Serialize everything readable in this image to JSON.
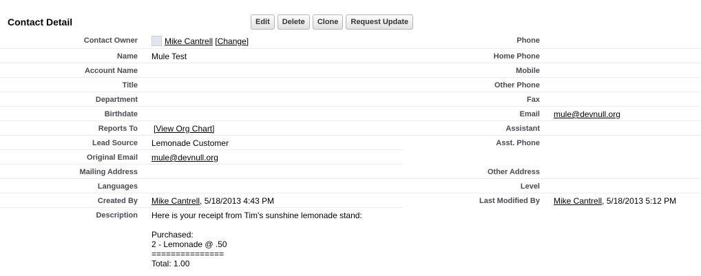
{
  "header": {
    "title": "Contact Detail"
  },
  "toolbar": {
    "edit": "Edit",
    "delete": "Delete",
    "clone": "Clone",
    "request_update": "Request Update"
  },
  "left": {
    "contact_owner": {
      "label": "Contact Owner",
      "name": "Mike Cantrell",
      "change": "[Change]"
    },
    "name": {
      "label": "Name",
      "value": "Mule Test"
    },
    "account_name": {
      "label": "Account Name",
      "value": ""
    },
    "title": {
      "label": "Title",
      "value": ""
    },
    "department": {
      "label": "Department",
      "value": ""
    },
    "birthdate": {
      "label": "Birthdate",
      "value": ""
    },
    "reports_to": {
      "label": "Reports To",
      "link": "[View Org Chart]"
    },
    "lead_source": {
      "label": "Lead Source",
      "value": "Lemonade Customer"
    },
    "original_email": {
      "label": "Original Email",
      "value": "mule@devnull.org"
    },
    "mailing_address": {
      "label": "Mailing Address",
      "value": ""
    },
    "languages": {
      "label": "Languages",
      "value": ""
    },
    "created_by": {
      "label": "Created By",
      "user": "Mike Cantrell",
      "date": ", 5/18/2013 4:43 PM"
    },
    "description": {
      "label": "Description",
      "lines": [
        "Here is your receipt from Tim's sunshine lemonade stand:",
        "",
        "Purchased:",
        "2 - Lemonade @ .50",
        "===============",
        "Total: 1.00"
      ]
    }
  },
  "right": {
    "phone": {
      "label": "Phone",
      "value": ""
    },
    "home_phone": {
      "label": "Home Phone",
      "value": ""
    },
    "mobile": {
      "label": "Mobile",
      "value": ""
    },
    "other_phone": {
      "label": "Other Phone",
      "value": ""
    },
    "fax": {
      "label": "Fax",
      "value": ""
    },
    "email": {
      "label": "Email",
      "value": "mule@devnull.org"
    },
    "assistant": {
      "label": "Assistant",
      "value": ""
    },
    "asst_phone": {
      "label": "Asst. Phone",
      "value": ""
    },
    "other_address": {
      "label": "Other Address",
      "value": ""
    },
    "level": {
      "label": "Level",
      "value": ""
    },
    "last_modified_by": {
      "label": "Last Modified By",
      "user": "Mike Cantrell",
      "date": ", 5/18/2013 5:12 PM"
    }
  }
}
